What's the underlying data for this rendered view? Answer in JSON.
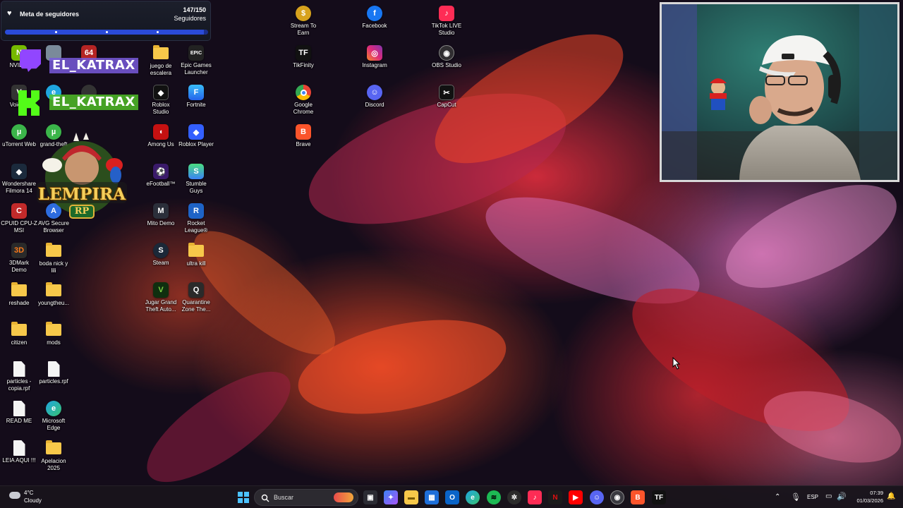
{
  "follower_goal": {
    "title": "Meta de seguidores",
    "count": "147/150",
    "subtitle": "Seguidores",
    "progress": 0.98
  },
  "overlay": {
    "twitch_name": "EL_KATRAX",
    "kick_name": "EL_KATRAX",
    "logo_text": "LEMPIRA",
    "logo_sub": "RP"
  },
  "desktop_icons": {
    "nvidia": "NVIDIA",
    "voicemeeter": "Voicem",
    "utorrent": "uTorrent Web",
    "grand_theft": "grand-theft",
    "filmora": "Wondershare\nFilmora 14",
    "cpuid": "CPUID CPU-Z\nMSI",
    "avg": "AVG Secure\nBrowser",
    "mark3d": "3DMark\nDemo",
    "boda": "boda nick y\nlili",
    "reshade": "reshade",
    "youngtheu": "youngtheu...",
    "citizen": "citizen",
    "mods": "mods",
    "particles_copy": "particles -\ncopia.rpf",
    "particles": "particles.rpf",
    "readme": "READ ME",
    "edge": "Microsoft\nEdge",
    "leia": "LEIA AQUI !!!",
    "apelacion": "Apelacion\n2025",
    "juego": "juego de\nescalera",
    "epic": "Epic Games\nLauncher",
    "roblox_studio": "Roblox\nStudio",
    "fortnite": "Fortnite",
    "among_us": "Among Us",
    "roblox_player": "Roblox Player",
    "efootball": "eFootball™",
    "stumble": "Stumble\nGuys",
    "mito": "Mito Demo",
    "rocket": "Rocket\nLeague®",
    "steam": "Steam",
    "ultra_kill": "ultra kill",
    "gta": "Jugar Grand\nTheft Auto...",
    "quarantine": "Quarantine\nZone The...",
    "stream_to_earn": "Stream To\nEarn",
    "tikfinity": "TikFinity",
    "chrome": "Google\nChrome",
    "brave": "Brave",
    "facebook": "Facebook",
    "instagram": "Instagram",
    "discord": "Discord",
    "tiktok_live": "TikTok LIVE\nStudio",
    "obs": "OBS Studio",
    "capcut": "CapCut"
  },
  "taskbar": {
    "weather_temp": "4°C",
    "weather_desc": "Cloudy",
    "search_placeholder": "Buscar",
    "language": "ESP",
    "time": "07:39",
    "date": "01/03/2026"
  },
  "colors": {
    "goal_bar": "#2a4bd8",
    "twitch": "#9146ff",
    "kick": "#53fc18",
    "taskbar_bg": "#18141c"
  }
}
